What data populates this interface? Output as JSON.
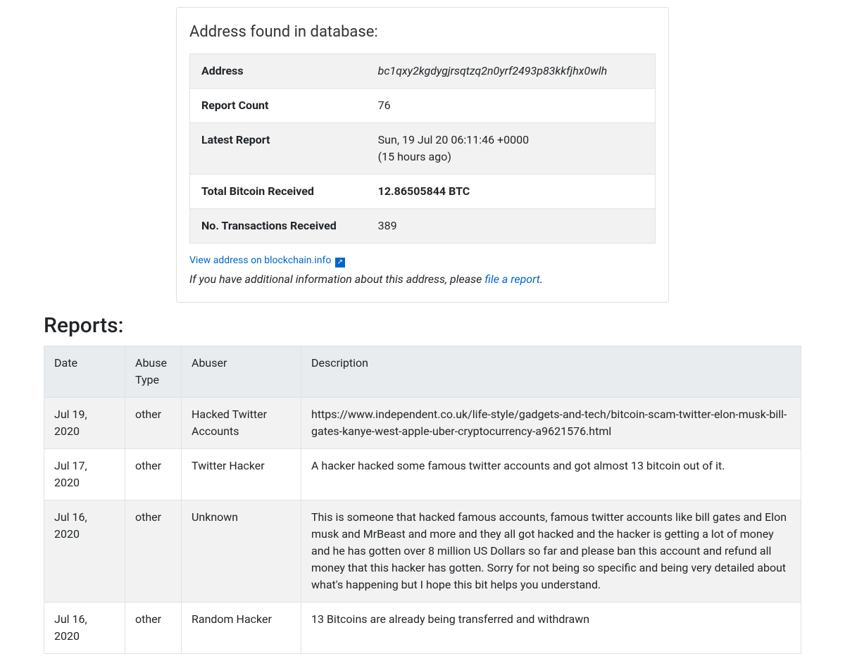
{
  "card": {
    "title": "Address found in database:",
    "rows": {
      "address_label": "Address",
      "address_value": "bc1qxy2kgdygjrsqtzq2n0yrf2493p83kkfjhx0wlh",
      "report_count_label": "Report Count",
      "report_count_value": "76",
      "latest_report_label": "Latest Report",
      "latest_report_value": "Sun, 19 Jul 20 06:11:46 +0000",
      "latest_report_relative": "(15 hours ago)",
      "total_received_label": "Total Bitcoin Received",
      "total_received_value": "12.86505844 BTC",
      "tx_received_label": "No. Transactions Received",
      "tx_received_value": "389"
    },
    "blockchain_link_text": "View address on blockchain.info",
    "additional_info_prefix": "If you have additional information about this address, please ",
    "file_report_link": "file a report",
    "additional_info_suffix": "."
  },
  "reports": {
    "heading": "Reports:",
    "columns": {
      "date": "Date",
      "type": "Abuse Type",
      "abuser": "Abuser",
      "description": "Description"
    },
    "rows": [
      {
        "date": "Jul 19, 2020",
        "type": "other",
        "abuser": "Hacked Twitter Accounts",
        "description": "https://www.independent.co.uk/life-style/gadgets-and-tech/bitcoin-scam-twitter-elon-musk-bill-gates-kanye-west-apple-uber-cryptocurrency-a9621576.html"
      },
      {
        "date": "Jul 17, 2020",
        "type": "other",
        "abuser": "Twitter Hacker",
        "description": "A hacker hacked some famous twitter accounts and got almost 13 bitcoin out of it."
      },
      {
        "date": "Jul 16, 2020",
        "type": "other",
        "abuser": "Unknown",
        "description": "This is someone that hacked famous accounts, famous twitter accounts like bill gates and Elon musk and MrBeast and more and they all got hacked and the hacker is getting a lot of money and he has gotten over 8 million US Dollars so far and please ban this account and refund all money that this hacker has gotten. Sorry for not being so specific and being very detailed about what's happening but I hope this bit helps you understand."
      },
      {
        "date": "Jul 16, 2020",
        "type": "other",
        "abuser": "Random Hacker",
        "description": "13 Bitcoins are already being transferred and withdrawn"
      }
    ]
  }
}
